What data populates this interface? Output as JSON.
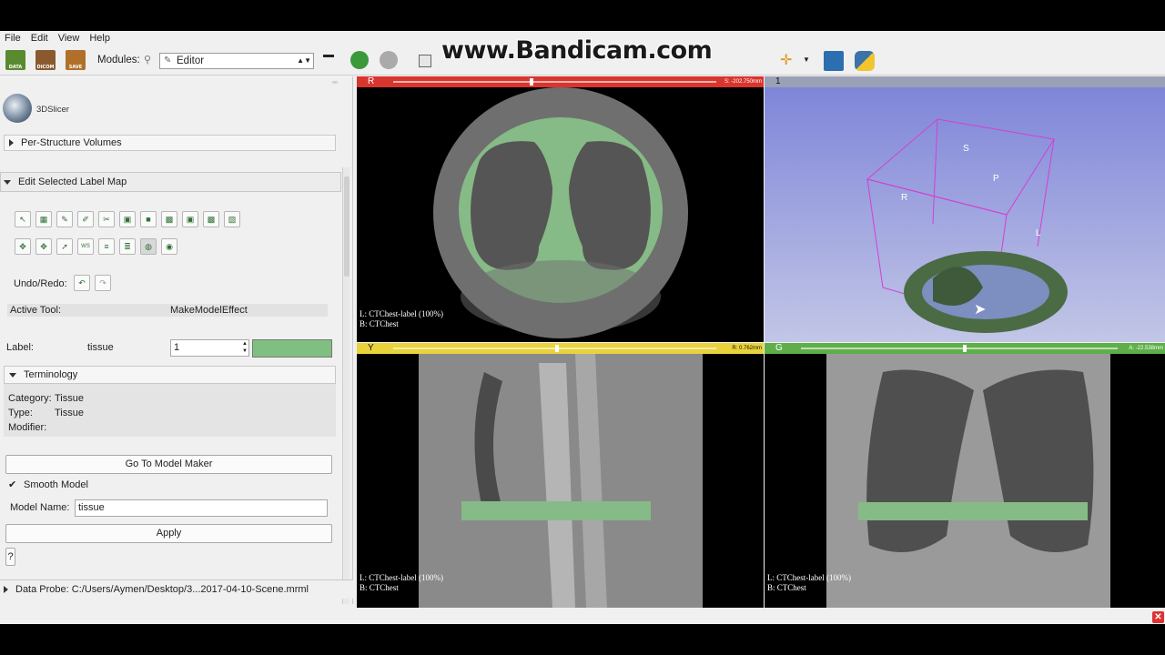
{
  "menus": [
    "File",
    "Edit",
    "View",
    "Help"
  ],
  "watermark": "www.Bandicam.com",
  "toolbar": {
    "data_label": "DATA",
    "dicom_label": "DICOM",
    "save_label": "SAVE",
    "modules_label": "Modules:",
    "module_selected": "Editor"
  },
  "left": {
    "app_name": "3DSlicer",
    "per_structure": "Per-Structure Volumes",
    "edit_label_map": "Edit Selected Label Map",
    "undo_redo": "Undo/Redo:",
    "active_tool_label": "Active Tool:",
    "active_tool_value": "MakeModelEffect",
    "label_label": "Label:",
    "label_name": "tissue",
    "label_value": "1",
    "label_color": "#7fbf7f",
    "terminology": "Terminology",
    "category_label": "Category:",
    "category_value": "Tissue",
    "type_label": "Type:",
    "type_value": "Tissue",
    "modifier_label": "Modifier:",
    "go_to_model_maker": "Go To Model Maker",
    "smooth_model": "Smooth Model",
    "model_name_label": "Model Name:",
    "model_name_value": "tissue",
    "apply": "Apply",
    "help": "?",
    "data_probe": "Data Probe: C:/Users/Aymen/Desktop/3...2017-04-10-Scene.mrml"
  },
  "views": {
    "red": {
      "letter": "R",
      "offset": "S: -202.750mm",
      "color": "#d9352f",
      "line1": "L: CTChest-label (100%)",
      "line2": "B: CTChest"
    },
    "threed": {
      "letter": "1",
      "labels": {
        "s": "S",
        "p": "P",
        "r": "R",
        "l": "L"
      }
    },
    "yellow": {
      "letter": "Y",
      "offset": "R: 0.762mm",
      "color": "#e9d33a",
      "line1": "L: CTChest-label (100%)",
      "line2": "B: CTChest"
    },
    "green": {
      "letter": "G",
      "offset": "A: -22.538mm",
      "color": "#5fae4a",
      "line1": "L: CTChest-label (100%)",
      "line2": "B: CTChest"
    }
  },
  "status_close": "✕"
}
